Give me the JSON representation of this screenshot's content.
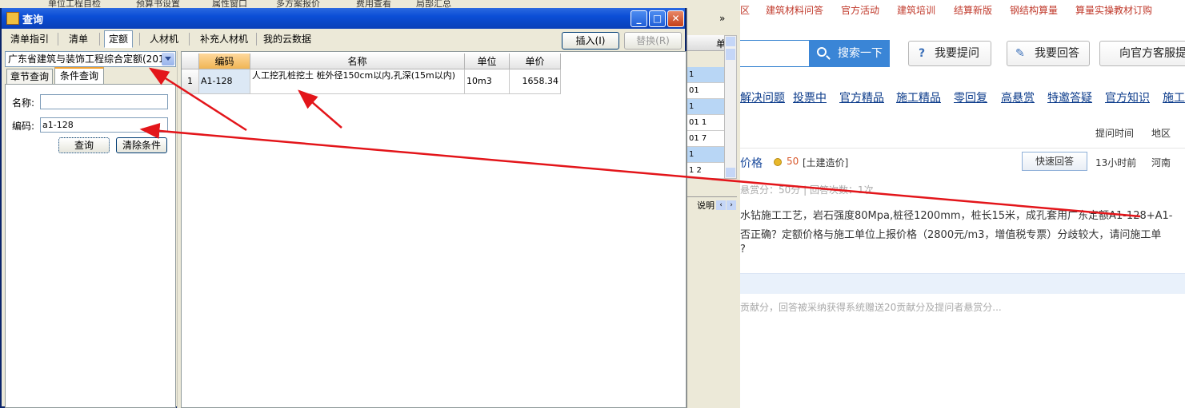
{
  "background_toolbar": {
    "items": [
      "单位工程自检",
      "预算书设置",
      "属性窗口",
      "多方案报价",
      "费用查看",
      "局部汇总"
    ]
  },
  "web": {
    "topnav": [
      "区",
      "建筑材料问答",
      "官方活动",
      "建筑培训",
      "结算新版",
      "钢结构算量",
      "算量实操教材订购"
    ],
    "search_button": "搜索一下",
    "ask_button": "我要提问",
    "answer_button": "我要回答",
    "service_button": "向官方客服提",
    "categories": [
      "解决问题",
      "投票中",
      "官方精品",
      "施工精品",
      "零回复",
      "高悬赏",
      "特邀答疑",
      "官方知识",
      "施工"
    ],
    "col_headers": {
      "time": "提问时间",
      "region": "地区"
    },
    "question": {
      "title": "价格",
      "score": "50",
      "tag": "[土建造价]",
      "quick_answer": "快速回答",
      "time": "13小时前",
      "region": "河南",
      "meta": "悬赏分：50分  |  回答次数：1次",
      "body_line1": "水钻施工工艺，岩石强度80Mpa,桩径1200mm，桩长15米，成孔套用广东定额A1-128+A1-",
      "body_line2": "否正确？定额价格与施工单位上报价格（2800元/m3，增值税专票）分歧较大，请问施工单",
      "body_line3": "?"
    },
    "footer_note": "贡献分，回答被采纳获得系统赠送20贡献分及提问者悬赏分..."
  },
  "middle_strip": {
    "header": "单",
    "rows": [
      "1",
      "01",
      "1",
      "01      1",
      "01      7",
      "1",
      "1       2"
    ],
    "shuoming": "说明"
  },
  "dialog": {
    "title": "查询",
    "tabs": [
      "清单指引",
      "清单",
      "定额",
      "人材机",
      "补充人材机",
      "我的云数据"
    ],
    "active_tab": "定额",
    "insert_button": "插入(I)",
    "replace_button": "替换(R)",
    "quota_library": "广东省建筑与装饰工程综合定额(201",
    "subtabs": [
      "章节查询",
      "条件查询"
    ],
    "active_subtab": "条件查询",
    "name_label": "名称:",
    "name_value": "",
    "code_label": "编码:",
    "code_value": "a1-128",
    "query_button": "查询",
    "clear_button": "清除条件",
    "grid": {
      "headers": [
        "编码",
        "名称",
        "单位",
        "单价"
      ],
      "rows": [
        {
          "index": "1",
          "code": "A1-128",
          "name": "人工挖孔桩挖土 桩外径150cm以内,孔深(15m以内)",
          "unit": "10m3",
          "price": "1658.34"
        }
      ]
    }
  },
  "colors": {
    "arrow": "#e3151a",
    "titlebar": "#0b4ed6",
    "accent_orange": "#f0b555"
  }
}
